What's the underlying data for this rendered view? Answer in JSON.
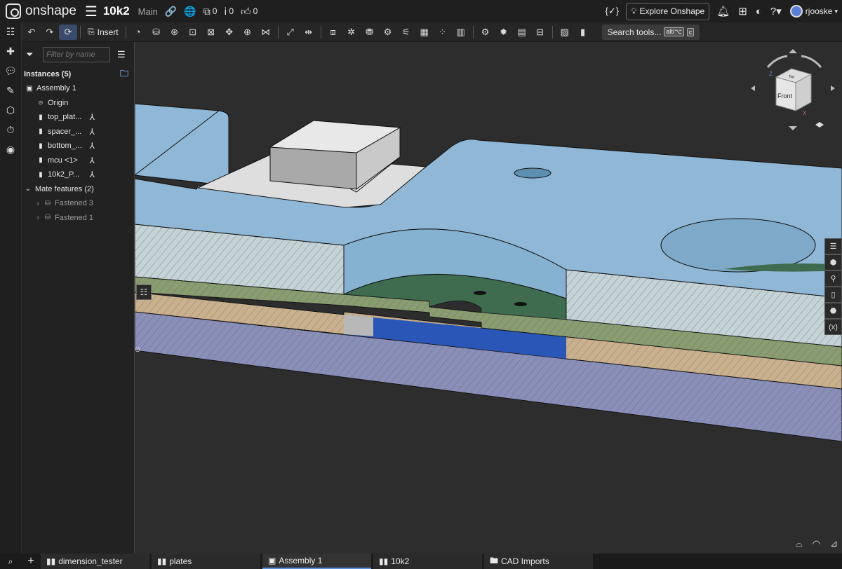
{
  "app": {
    "brand": "onshape",
    "doc_name": "10k2",
    "branch": "Main"
  },
  "topbar": {
    "versions_count": "0",
    "comments_count": "0",
    "likes_count": "0",
    "explore_label": "Explore Onshape",
    "user_name": "rjooske",
    "curly_label": "{✓}"
  },
  "toolbar": {
    "insert_label": "Insert",
    "search_label": "Search tools...",
    "search_kbd_1": "alt/⌥",
    "search_kbd_2": "c"
  },
  "panel": {
    "filter_placeholder": "Filter by name",
    "instances_header": "Instances (5)",
    "assembly": "Assembly 1",
    "origin": "Origin",
    "instances": [
      "top_plat...",
      "spacer_...",
      "bottom_...",
      "mcu <1>",
      "10k2_P..."
    ],
    "mate_header": "Mate features (2)",
    "mates": [
      "Fastened 3",
      "Fastened 1"
    ]
  },
  "navcube": {
    "front_label": "Front",
    "top_label": "Top",
    "axis_z": "Z",
    "axis_x": "X"
  },
  "tabs": [
    {
      "label": "dimension_tester",
      "icon": "part-studio-icon"
    },
    {
      "label": "plates",
      "icon": "part-studio-icon"
    },
    {
      "label": "Assembly 1",
      "icon": "assembly-icon",
      "active": true
    },
    {
      "label": "10k2",
      "icon": "part-studio-icon"
    },
    {
      "label": "CAD Imports",
      "icon": "folder-icon"
    }
  ],
  "colors": {
    "plate_blue": "#90b8d6",
    "spacer_green": "#3f6b4f",
    "hole_blue": "#2a56b8",
    "tan_layer": "#c9b08e",
    "purple_layer": "#8a8fb8",
    "background": "#2d2d2d"
  }
}
